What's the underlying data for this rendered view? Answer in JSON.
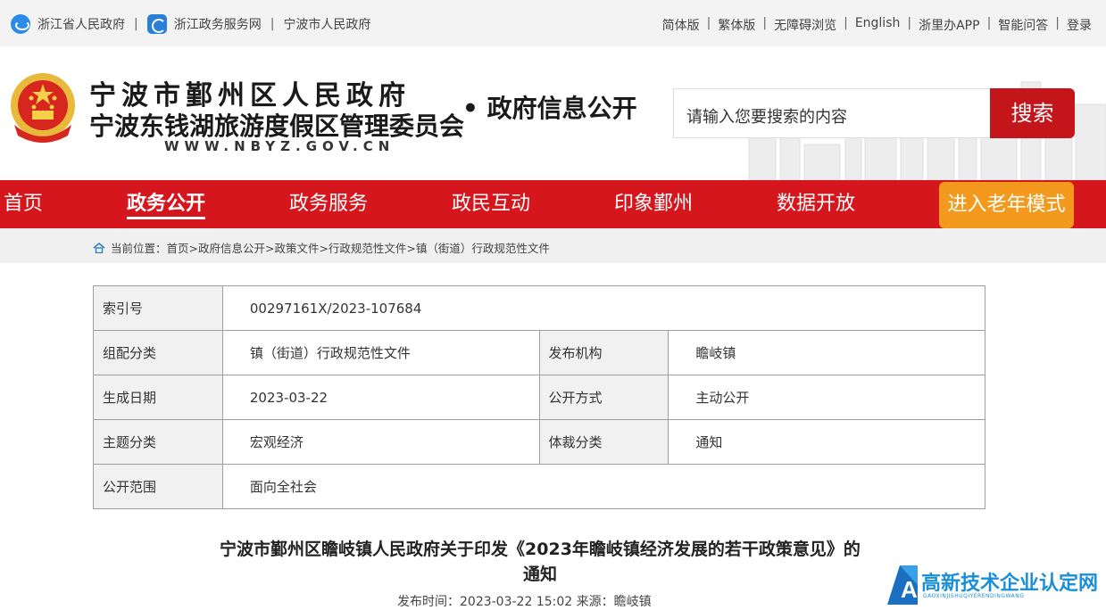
{
  "topbar": {
    "left_links": [
      "浙江省人民政府",
      "浙江政务服务网",
      "宁波市人民政府"
    ],
    "right_links": [
      "简体版",
      "繁体版",
      "无障碍浏览",
      "English",
      "浙里办APP",
      "智能问答",
      "登录"
    ]
  },
  "header": {
    "title_line1": "宁波市鄞州区人民政府",
    "title_line2": "宁波东钱湖旅游度假区管理委员会",
    "url_text": "WWW.NBYZ.GOV.CN",
    "section": "• 政府信息公开",
    "search_placeholder": "请输入您要搜索的内容",
    "search_button": "搜索"
  },
  "nav": {
    "items": [
      "首页",
      "政务公开",
      "政务服务",
      "政民互动",
      "印象鄞州",
      "数据开放"
    ],
    "active": "政务公开",
    "elder_mode": "进入老年模式"
  },
  "breadcrumb": {
    "prefix": "当前位置：",
    "path": "首页>政府信息公开>政策文件>行政规范性文件>镇（街道）行政规范性文件"
  },
  "info_table": {
    "index_label": "索引号",
    "index_value": "00297161X/2023-107684",
    "category_label": "组配分类",
    "category_value": "镇（街道）行政规范性文件",
    "issuer_label": "发布机构",
    "issuer_value": "瞻岐镇",
    "date_label": "生成日期",
    "date_value": "2023-03-22",
    "disclosure_label": "公开方式",
    "disclosure_value": "主动公开",
    "topic_label": "主题分类",
    "topic_value": "宏观经济",
    "genre_label": "体裁分类",
    "genre_value": "通知",
    "scope_label": "公开范围",
    "scope_value": "面向全社会"
  },
  "document": {
    "title_line1": "宁波市鄞州区瞻岐镇人民政府关于印发《2023年瞻岐镇经济发展的若干政策意见》的",
    "title_line2": "通知",
    "meta": "发布时间：2023-03-22 15:02 来源：瞻岐镇"
  },
  "watermark": {
    "text": "高新技术企业认定网",
    "sub": "GAOXINJISHUQIYERENDINGWANG"
  },
  "colors": {
    "nav_red": "#d6161d",
    "elder_orange": "#f39a1e",
    "search_red": "#c4151b",
    "watermark_blue": "#1a8fd8"
  }
}
